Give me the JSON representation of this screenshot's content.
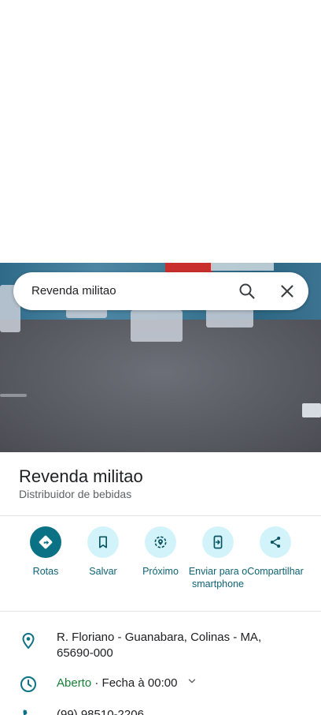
{
  "search": {
    "query": "Revenda militao",
    "search_icon": "search-icon",
    "close_icon": "close-icon"
  },
  "place": {
    "name": "Revenda militao",
    "category": "Distribuidor de bebidas"
  },
  "actions": [
    {
      "label": "Rotas",
      "icon": "directions-icon"
    },
    {
      "label": "Salvar",
      "icon": "bookmark-icon"
    },
    {
      "label": "Próximo",
      "icon": "nearby-icon"
    },
    {
      "label": "Enviar para o smartphone",
      "icon": "send-to-phone-icon"
    },
    {
      "label": "Compartilhar",
      "icon": "share-icon"
    }
  ],
  "info": {
    "address": "R. Floriano - Guanabara, Colinas - MA, 65690-000",
    "hours_status": "Aberto",
    "hours_detail": " · Fecha à 00:00",
    "phone": "(99) 98510-2206"
  },
  "colors": {
    "accent": "#0b7285",
    "action_bg": "#d3f3fb",
    "action_text": "#0d6373",
    "open_green": "#188038"
  }
}
